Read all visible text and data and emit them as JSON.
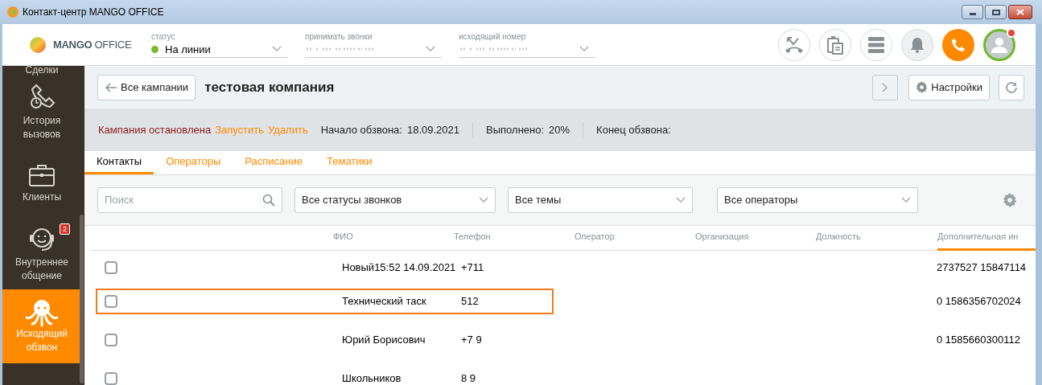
{
  "window": {
    "title": "Контакт-центр MANGO OFFICE"
  },
  "header": {
    "logo": {
      "word1": "MANGO",
      "word2": "OFFICE"
    },
    "fields": [
      {
        "label": "статус",
        "value": "На линии",
        "color": "#7cb82f"
      },
      {
        "label": "принимать звонки"
      },
      {
        "label": "исходящий номер"
      }
    ],
    "toolbar": [
      {
        "kind": "transfer"
      },
      {
        "kind": "clipboard"
      },
      {
        "kind": "list"
      },
      {
        "kind": "bell"
      },
      {
        "kind": "call"
      },
      {
        "kind": "avatar",
        "notification": true
      }
    ]
  },
  "sidebar": {
    "items": [
      {
        "kind": "deals",
        "label": "Сделки",
        "selected": false
      },
      {
        "kind": "history",
        "label": "История вызовов",
        "selected": false
      },
      {
        "kind": "clients",
        "label": "Клиенты",
        "selected": false
      },
      {
        "kind": "chat",
        "label": "Внутреннее общение",
        "selected": false,
        "badge": "2"
      },
      {
        "kind": "dialer",
        "label": "Исходящий обзвон",
        "selected": true
      }
    ]
  },
  "campaign": {
    "back_button": "Все кампании",
    "title": "тестовая компания",
    "settings_button": "Настройки",
    "state": "Кампания остановлена",
    "actions": [
      "Запустить",
      "Удалить"
    ],
    "stats": [
      {
        "label": "Начало обзвона:",
        "value": "18.09.2021"
      },
      {
        "label": "Выполнено:",
        "value": "20%"
      },
      {
        "label": "Конец обзвона:"
      }
    ]
  },
  "tabs": [
    {
      "label": "Контакты",
      "selected": true
    },
    {
      "label": "Операторы",
      "selected": false
    },
    {
      "label": "Расписание",
      "selected": false
    },
    {
      "label": "Тематики",
      "selected": false
    }
  ],
  "filters": {
    "search": {
      "placeholder": "Поиск"
    },
    "selects": [
      "Все статусы звонков",
      "Все темы",
      "Все операторы"
    ]
  },
  "table": {
    "columns": [
      {
        "label": "ФИО",
        "sorted": false
      },
      {
        "label": "Телефон",
        "sorted": false
      },
      {
        "label": "Оператор",
        "sorted": false
      },
      {
        "label": "Организация",
        "sorted": false
      },
      {
        "label": "Должность",
        "sorted": false
      },
      {
        "label": "Дополнительная ин",
        "sorted": true
      }
    ],
    "rows": [
      {
        "checked": false,
        "focused": false,
        "name": "Новый15:52 14.09.2021",
        "phone": "+711",
        "extra": "2737527 15847114"
      },
      {
        "checked": false,
        "focused": true,
        "name": "Технический таск",
        "phone": "512",
        "extra": "0 1586356702024"
      },
      {
        "checked": false,
        "focused": false,
        "name": "Юрий Борисович",
        "phone": "+7 9",
        "extra": "0 1585660300112"
      },
      {
        "checked": false,
        "focused": false,
        "name": "Школьников",
        "phone": "8 9"
      }
    ]
  }
}
